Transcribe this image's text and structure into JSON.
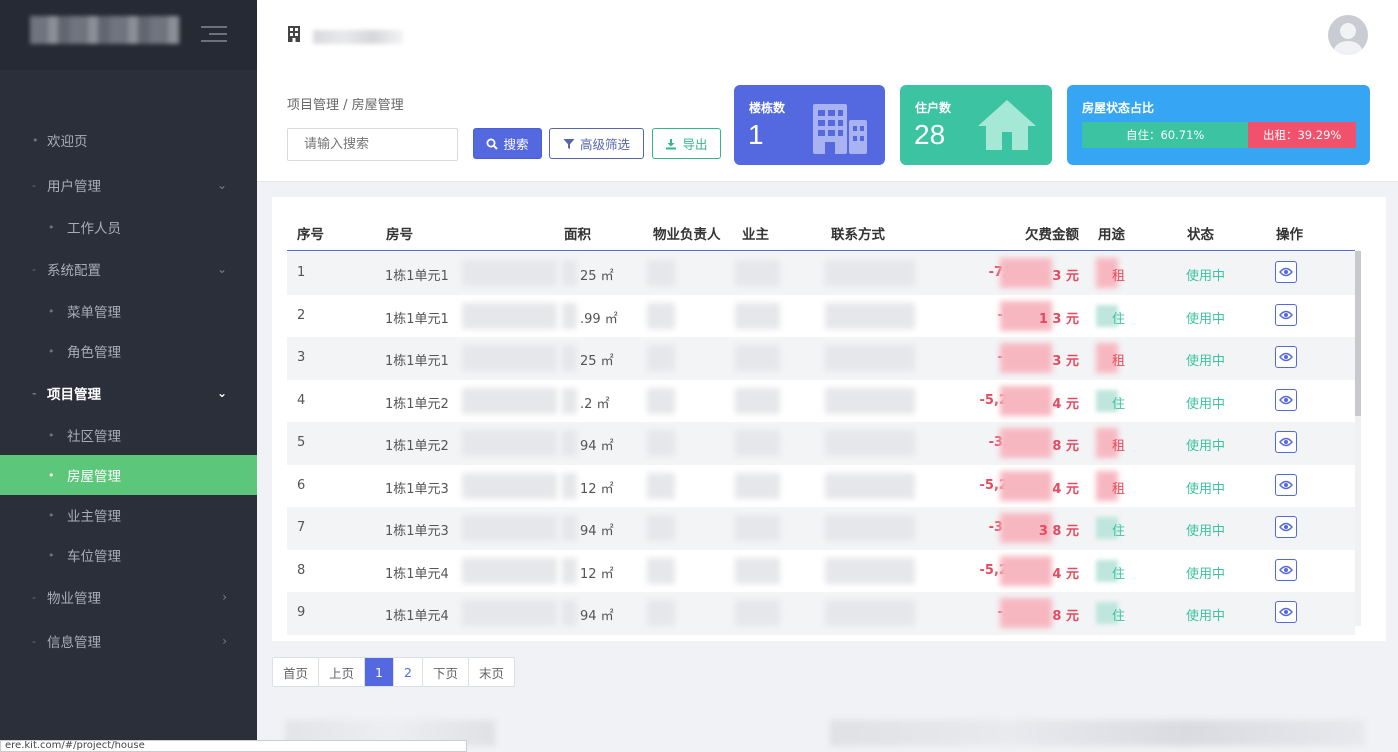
{
  "sidebar": {
    "items": [
      {
        "label": "欢迎页",
        "type": "top"
      },
      {
        "label": "用户管理",
        "type": "group"
      },
      {
        "label": "工作人员",
        "type": "sub"
      },
      {
        "label": "系统配置",
        "type": "group"
      },
      {
        "label": "菜单管理",
        "type": "sub"
      },
      {
        "label": "角色管理",
        "type": "sub"
      },
      {
        "label": "项目管理",
        "type": "group-open"
      },
      {
        "label": "社区管理",
        "type": "sub"
      },
      {
        "label": "房屋管理",
        "type": "sub-active"
      },
      {
        "label": "业主管理",
        "type": "sub"
      },
      {
        "label": "车位管理",
        "type": "sub"
      },
      {
        "label": "物业管理",
        "type": "group-closed"
      },
      {
        "label": "信息管理",
        "type": "group-closed"
      }
    ]
  },
  "header": {
    "icon": "building-icon"
  },
  "breadcrumb": "项目管理 / 房屋管理",
  "search": {
    "placeholder": "请输入搜索",
    "search_label": "搜索",
    "advanced_label": "高级筛选",
    "export_label": "导出"
  },
  "stats": {
    "buildings": {
      "label": "楼栋数",
      "value": "1"
    },
    "residents": {
      "label": "住户数",
      "value": "28"
    },
    "ratio": {
      "label": "房屋状态占比",
      "self_label": "自住：60.71%",
      "self_pct": 60.71,
      "rent_label": "出租：39.29%",
      "rent_pct": 39.29
    }
  },
  "table": {
    "headers": [
      "序号",
      "房号",
      "面积",
      "物业负责人",
      "业主",
      "联系方式",
      "欠费金额",
      "用途",
      "状态",
      "操作"
    ],
    "rows": [
      {
        "no": "1",
        "room": "1栋1单元1",
        "area": "25 ㎡",
        "debt_a": "-7,1",
        "debt_b": "3 元",
        "use": "租",
        "status": "使用中",
        "rent": true
      },
      {
        "no": "2",
        "room": "1栋1单元1",
        "area": ".99 ㎡",
        "debt_a": "-5,",
        "debt_b": "1 3 元",
        "use": "住",
        "status": "使用中",
        "rent": false
      },
      {
        "no": "3",
        "room": "1栋1单元1",
        "area": "25 ㎡",
        "debt_a": "-7,",
        "debt_b": "3 元",
        "use": "租",
        "status": "使用中",
        "rent": true
      },
      {
        "no": "4",
        "room": "1栋1单元2",
        "area": ".2 ㎡",
        "debt_a": "-5,24",
        "debt_b": "4 元",
        "use": "住",
        "status": "使用中",
        "rent": false
      },
      {
        "no": "5",
        "room": "1栋1单元2",
        "area": "94 ㎡",
        "debt_a": "-3,6",
        "debt_b": "8 元",
        "use": "租",
        "status": "使用中",
        "rent": true
      },
      {
        "no": "6",
        "room": "1栋1单元3",
        "area": "12 ㎡",
        "debt_a": "-5,24",
        "debt_b": "4 元",
        "use": "租",
        "status": "使用中",
        "rent": true
      },
      {
        "no": "7",
        "room": "1栋1单元3",
        "area": "94 ㎡",
        "debt_a": "-3,6",
        "debt_b": "3 8 元",
        "use": "住",
        "status": "使用中",
        "rent": false
      },
      {
        "no": "8",
        "room": "1栋1单元4",
        "area": "12 ㎡",
        "debt_a": "-5,24",
        "debt_b": "4 元",
        "use": "住",
        "status": "使用中",
        "rent": false
      },
      {
        "no": "9",
        "room": "1栋1单元4",
        "area": "94 ㎡",
        "debt_a": "-3,",
        "debt_b": "8 元",
        "use": "住",
        "status": "使用中",
        "rent": false
      }
    ]
  },
  "pagination": {
    "first": "首页",
    "prev": "上页",
    "pages": [
      "1",
      "2"
    ],
    "current": "1",
    "next": "下页",
    "last": "末页"
  },
  "statusbar": "ere.kit.com/#/project/house",
  "colors": {
    "accent": "#5468e0",
    "green": "#3cc3a1",
    "red": "#e54a5e",
    "sidebar": "#2b2f3a",
    "active": "#5cc77a"
  }
}
